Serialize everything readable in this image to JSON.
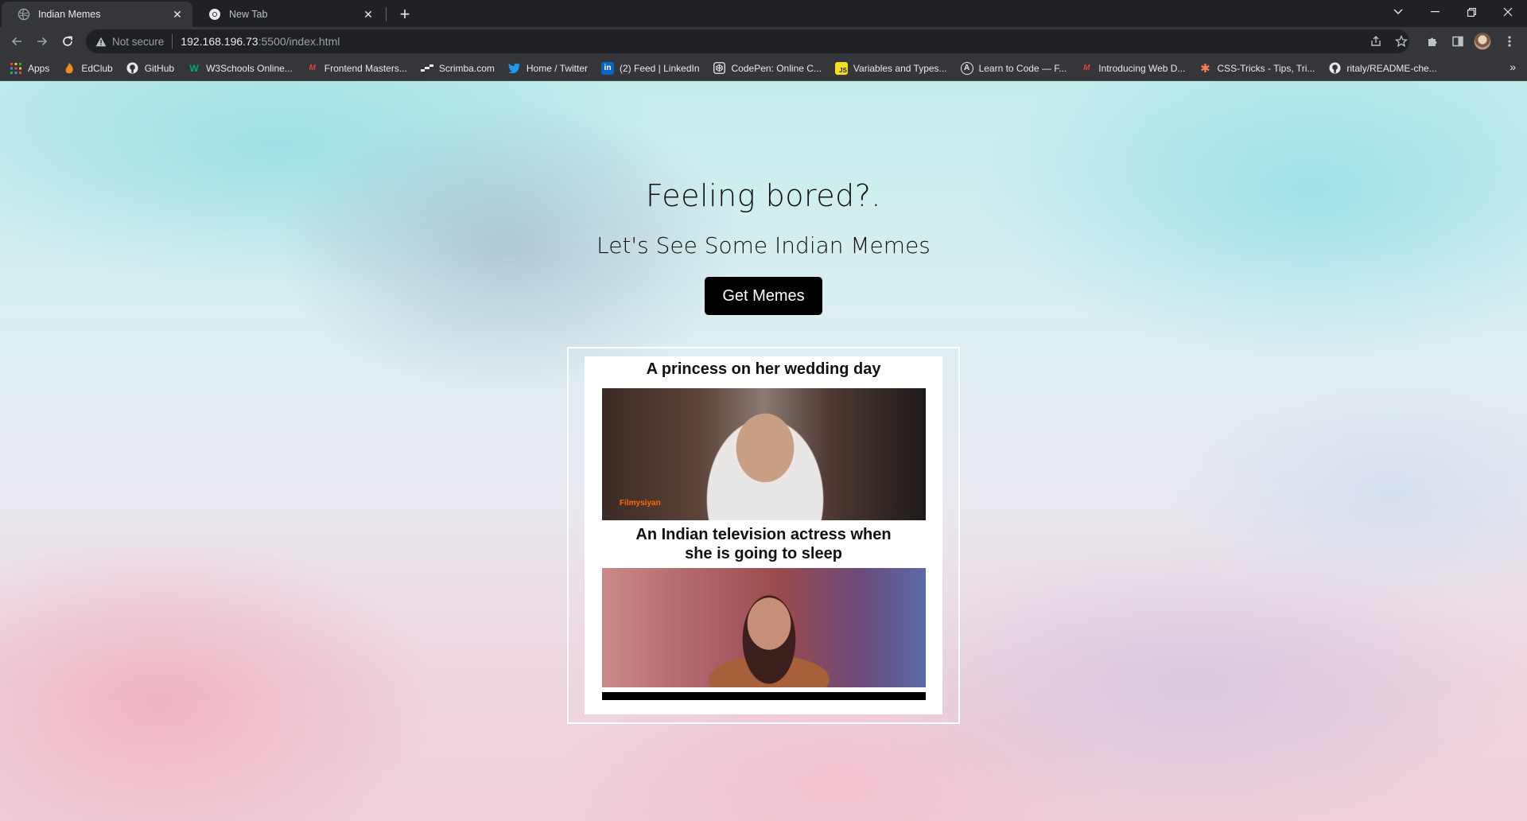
{
  "browser": {
    "tabs": [
      {
        "title": "Indian Memes",
        "active": true
      },
      {
        "title": "New Tab",
        "active": false
      }
    ],
    "address": {
      "security_label": "Not secure",
      "host": "192.168.196.73",
      "path": ":5500/index.html"
    },
    "bookmarks": [
      {
        "label": "Apps",
        "icon": "apps-grid-icon"
      },
      {
        "label": "EdClub",
        "icon": "edclub-icon"
      },
      {
        "label": "GitHub",
        "icon": "github-icon"
      },
      {
        "label": "W3Schools Online...",
        "icon": "w3schools-icon"
      },
      {
        "label": "Frontend Masters...",
        "icon": "frontend-masters-icon"
      },
      {
        "label": "Scrimba.com",
        "icon": "scrimba-icon"
      },
      {
        "label": "Home / Twitter",
        "icon": "twitter-icon"
      },
      {
        "label": "(2) Feed | LinkedIn",
        "icon": "linkedin-icon"
      },
      {
        "label": "CodePen: Online C...",
        "icon": "codepen-icon"
      },
      {
        "label": "Variables and Types...",
        "icon": "js-icon"
      },
      {
        "label": "Learn to Code — F...",
        "icon": "freecodecamp-icon"
      },
      {
        "label": "Introducing Web D...",
        "icon": "frontend-masters-icon"
      },
      {
        "label": "CSS-Tricks - Tips, Tri...",
        "icon": "css-tricks-icon"
      },
      {
        "label": "ritaly/README-che...",
        "icon": "github-icon"
      }
    ],
    "colors": {
      "chrome_dark": "#202124",
      "chrome_toolbar": "#35363a",
      "text": "#e8eaed"
    }
  },
  "page": {
    "heading": "Feeling bored?.",
    "subheading": "Let's See Some Indian Memes",
    "button_label": "Get Memes",
    "meme": {
      "caption_top": "A princess on her wedding day",
      "caption_bottom_line1": "An Indian television actress when",
      "caption_bottom_line2": "she is going to sleep",
      "watermark": "Filmysiyan"
    },
    "colors": {
      "button_bg": "#000000",
      "button_text": "#ffffff"
    }
  }
}
